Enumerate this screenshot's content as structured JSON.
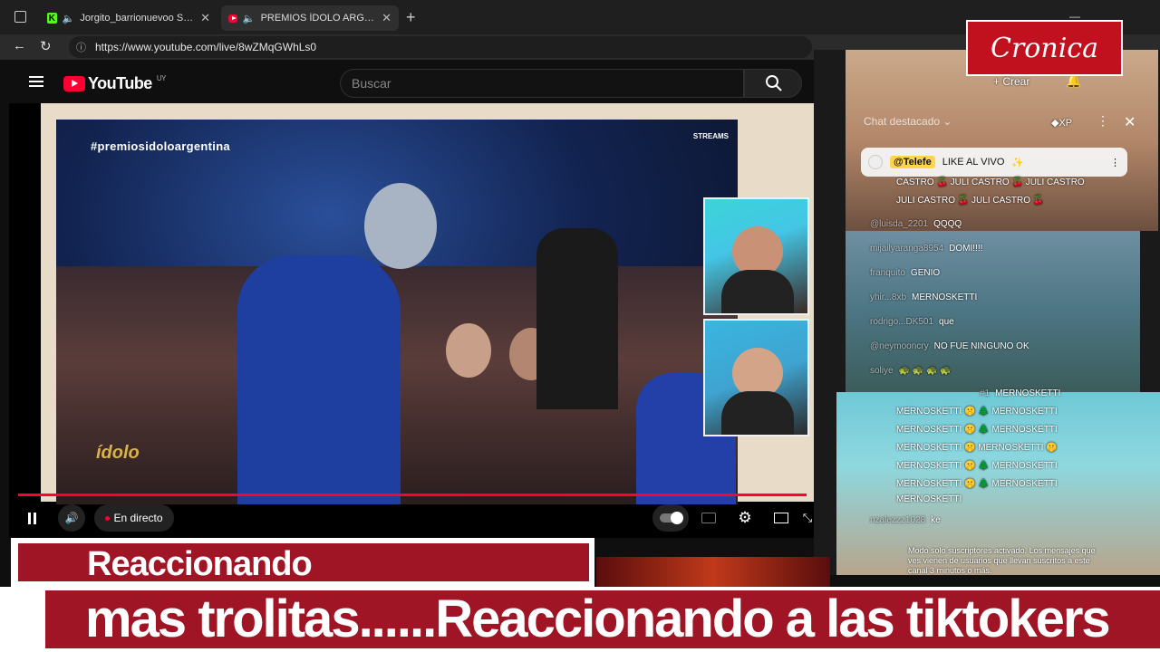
{
  "browser": {
    "tabs": [
      {
        "label": "Jorgito_barrionuevoo Stream",
        "active": false
      },
      {
        "label": "PREMIOS ÍDOLO ARGENTINA",
        "active": true
      }
    ],
    "url": "https://www.youtube.com/live/8wZMqGWhLs0"
  },
  "youtube": {
    "logo_text": "YouTube",
    "country_code": "UY",
    "search_placeholder": "Buscar",
    "create_label": "Crear"
  },
  "video": {
    "hashtag": "#premiosidoloargentina",
    "streams_badge": "STREAMS",
    "show_logo": "ídolo",
    "live_label": "En directo"
  },
  "chat": {
    "header": "Chat destacado",
    "points_label": "XP",
    "pinned": {
      "handle": "@Telefe",
      "message": "LIKE AL VIVO"
    },
    "messages": [
      {
        "user": "",
        "text": "CASTRO 🍒 JULI CASTRO 🍒 JULI CASTRO"
      },
      {
        "user": "",
        "text": "JULI CASTRO 🍒 JULI CASTRO 🍒"
      },
      {
        "user": "@luisda_2201",
        "text": "QQQQ"
      },
      {
        "user": "mijailyaranga8954",
        "text": "DOMI!!!!"
      },
      {
        "user": "franquito",
        "text": "GENIO"
      },
      {
        "user": "yhir...8xb",
        "text": "MERNOSKETTI"
      },
      {
        "user": "rodrigo...DK501",
        "text": "que"
      },
      {
        "user": "@neymooncry",
        "text": "NO FUE NINGUNO OK"
      },
      {
        "user": "soliye",
        "text": "🐢 🐢 🐢 🐢"
      },
      {
        "user": "#1",
        "text": "MERNOSKETTI"
      },
      {
        "user": "",
        "text": "MERNOSKETTI 🤫 🌲 MERNOSKETTI"
      },
      {
        "user": "",
        "text": "MERNOSKETTI 🤫 🌲 MERNOSKETTI"
      },
      {
        "user": "",
        "text": "MERNOSKETTI 🤫 MERNOSKETTI 🤫"
      },
      {
        "user": "",
        "text": "MERNOSKETTI 🤫 🌲 MERNOSKETTI"
      },
      {
        "user": "",
        "text": "MERNOSKETTI 🤫 🌲 MERNOSKETTI"
      },
      {
        "user": "",
        "text": "MERNOSKETTI"
      },
      {
        "user": "nzalezzz1028",
        "text": "ke"
      }
    ],
    "notice": "Modo solo suscriptores activado. Los mensajes que ves vienen de usuarios que llevan suscritos a este canal 3 minutos o más."
  },
  "overlay": {
    "brand": "Cronica",
    "banner_label": "Reaccionando",
    "ticker": "mas trolitas......Reaccionando a las tiktokers"
  },
  "colors": {
    "youtube_red": "#ff0033",
    "cronica_red": "#a01525"
  }
}
